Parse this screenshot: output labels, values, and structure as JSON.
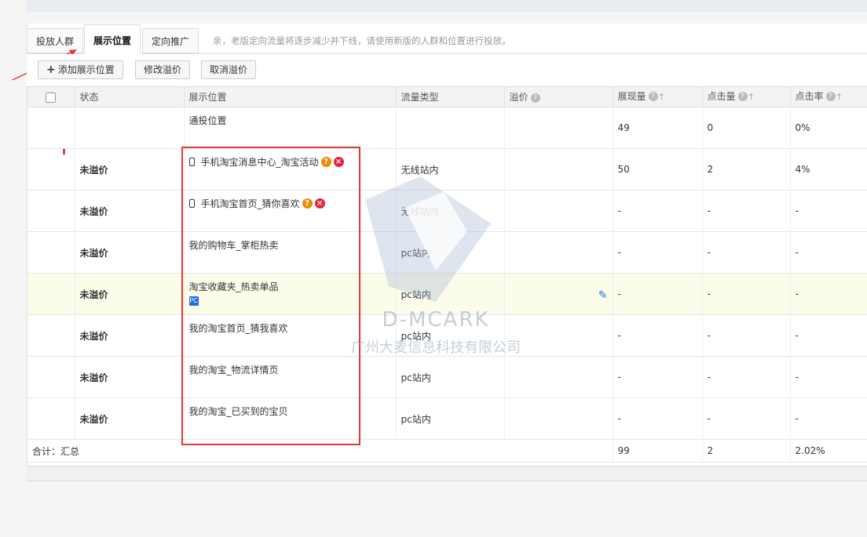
{
  "tabs": [
    {
      "label": "投放人群",
      "active": false
    },
    {
      "label": "展示位置",
      "active": true
    },
    {
      "label": "定向推广",
      "active": false
    }
  ],
  "notice": "亲，老版定向流量将逐步减少并下线，请使用新版的人群和位置进行投放。",
  "toolbar": {
    "add_label": "添加展示位置",
    "edit_bid_label": "修改溢价",
    "cancel_bid_label": "取消溢价"
  },
  "columns": {
    "status": "状态",
    "position": "展示位置",
    "traffic_type": "流量类型",
    "premium": "溢价",
    "impressions": "展现量",
    "clicks": "点击量",
    "ctr": "点击率"
  },
  "rows": [
    {
      "status": "",
      "position": "通投位置",
      "traffic": "",
      "impressions": "49",
      "clicks": "0",
      "ctr": "0%"
    },
    {
      "status": "未溢价",
      "position": "手机淘宝消息中心_淘宝活动",
      "traffic": "无线站内",
      "impressions": "50",
      "clicks": "2",
      "ctr": "4%"
    },
    {
      "status": "未溢价",
      "position": "手机淘宝首页_猜你喜欢",
      "traffic": "无线站内",
      "impressions": "-",
      "clicks": "-",
      "ctr": "-"
    },
    {
      "status": "未溢价",
      "position": "我的购物车_掌柜热卖",
      "traffic": "pc站内",
      "impressions": "-",
      "clicks": "-",
      "ctr": "-"
    },
    {
      "status": "未溢价",
      "position": "淘宝收藏夹_热卖单品",
      "traffic": "pc站内",
      "impressions": "-",
      "clicks": "-",
      "ctr": "-"
    },
    {
      "status": "未溢价",
      "position": "我的淘宝首页_猜我喜欢",
      "traffic": "pc站内",
      "impressions": "-",
      "clicks": "-",
      "ctr": "-"
    },
    {
      "status": "未溢价",
      "position": "我的淘宝_物流详情页",
      "traffic": "pc站内",
      "impressions": "-",
      "clicks": "-",
      "ctr": "-"
    },
    {
      "status": "未溢价",
      "position": "我的淘宝_已买到的宝贝",
      "traffic": "pc站内",
      "impressions": "-",
      "clicks": "-",
      "ctr": "-"
    }
  ],
  "total": {
    "label": "合计：汇总",
    "impressions": "99",
    "clicks": "2",
    "ctr": "2.02%"
  },
  "watermark": {
    "brand": "D-MCARK",
    "company": "广州大麦信息科技有限公司"
  },
  "icons": {
    "hint": "question-icon",
    "sort": "arrow-up-icon",
    "mobile": "phone-icon",
    "pc": "pc-icon",
    "edit": "pencil-icon",
    "remove": "close-icon"
  },
  "colors": {
    "status": "#f07700",
    "highlight": "#e53935",
    "accent": "#1e6fd9"
  }
}
